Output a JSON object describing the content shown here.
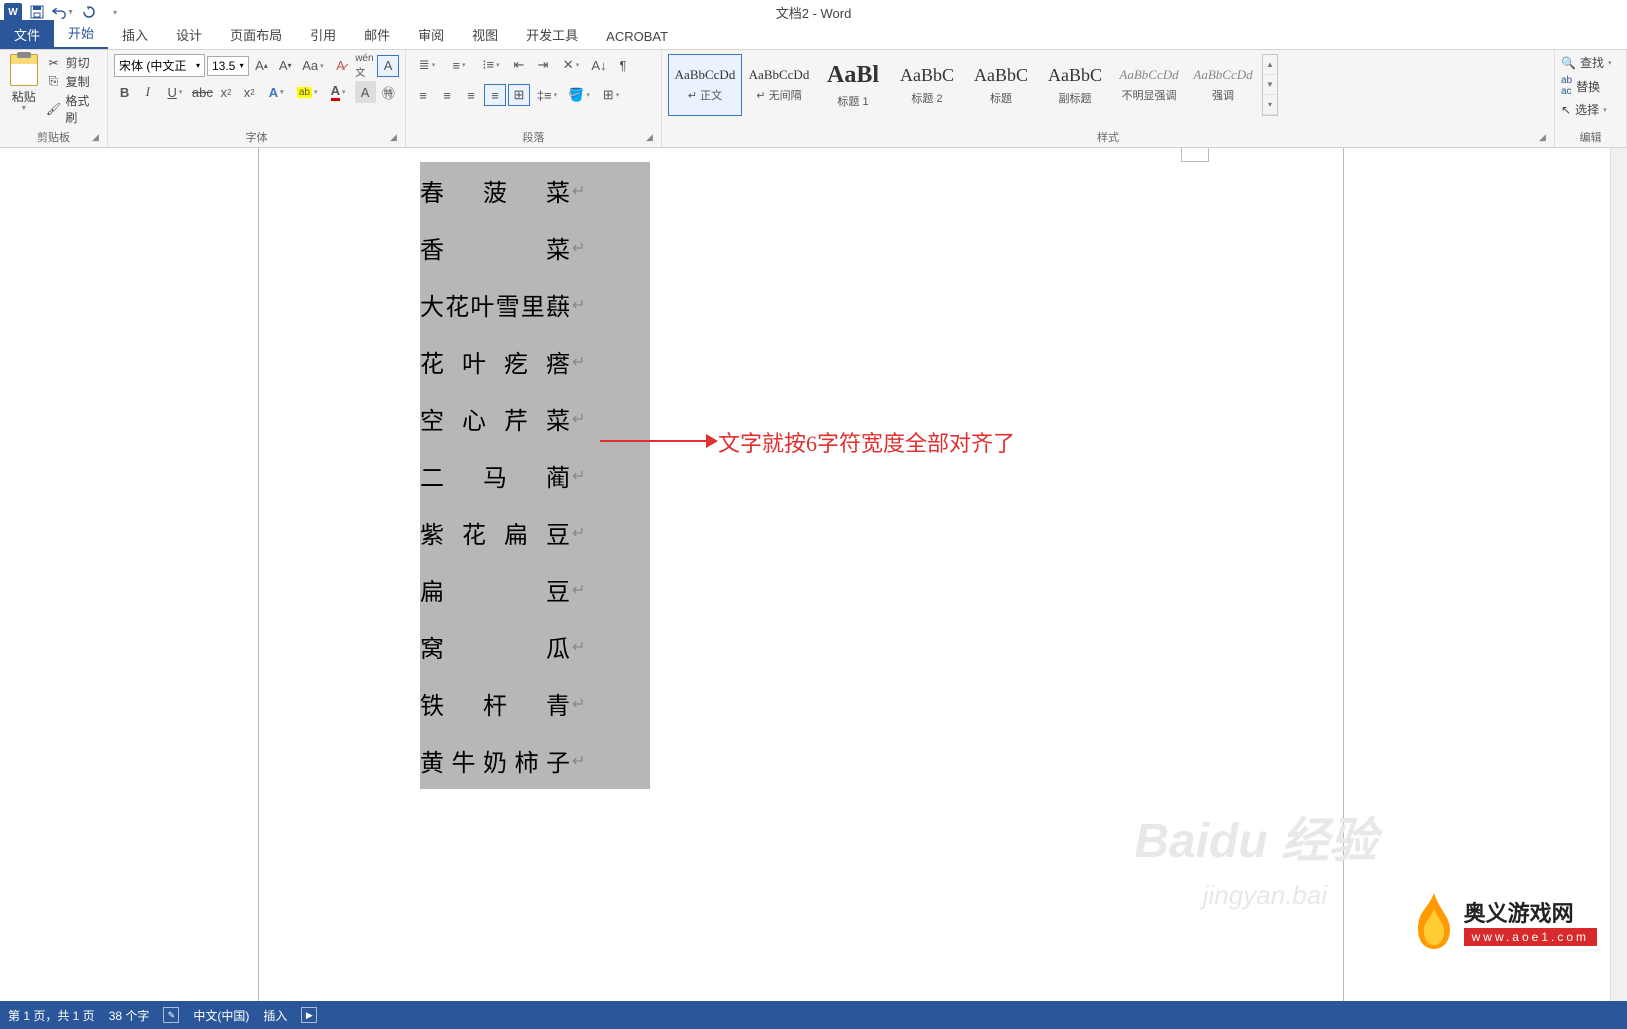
{
  "app": {
    "title": "文档2 - Word"
  },
  "qat": {
    "save": "save",
    "undo": "undo",
    "redo": "redo"
  },
  "tabs": {
    "file": "文件",
    "home": "开始",
    "insert": "插入",
    "design": "设计",
    "layout": "页面布局",
    "references": "引用",
    "mailings": "邮件",
    "review": "审阅",
    "view": "视图",
    "developer": "开发工具",
    "acrobat": "ACROBAT"
  },
  "clipboard": {
    "paste": "粘贴",
    "cut": "剪切",
    "copy": "复制",
    "formatPainter": "格式刷",
    "group": "剪贴板"
  },
  "font": {
    "name": "宋体 (中文正",
    "size": "13.5",
    "group": "字体",
    "bold": "B",
    "italic": "I",
    "underline": "U",
    "strike": "abc",
    "sub": "x",
    "sup": "x"
  },
  "paragraph": {
    "group": "段落"
  },
  "styles": {
    "group": "样式",
    "items": [
      {
        "preview": "AaBbCcDd",
        "name": "↵ 正文",
        "size": "13px"
      },
      {
        "preview": "AaBbCcDd",
        "name": "↵ 无间隔",
        "size": "13px"
      },
      {
        "preview": "AaBl",
        "name": "标题 1",
        "size": "24px",
        "bold": true
      },
      {
        "preview": "AaBbC",
        "name": "标题 2",
        "size": "18px"
      },
      {
        "preview": "AaBbC",
        "name": "标题",
        "size": "18px"
      },
      {
        "preview": "AaBbC",
        "name": "副标题",
        "size": "18px"
      },
      {
        "preview": "AaBbCcDd",
        "name": "不明显强调",
        "size": "13px",
        "italic": true,
        "gray": true
      },
      {
        "preview": "AaBbCcDd",
        "name": "强调",
        "size": "13px",
        "italic": true,
        "gray": true
      }
    ]
  },
  "editing": {
    "find": "查找",
    "replace": "替换",
    "select": "选择",
    "group": "编辑"
  },
  "document": {
    "lines": [
      "春菠菜",
      "香菜",
      "大花叶雪里蕻",
      "花叶疙瘩",
      "空心芹菜",
      "二马蔺",
      "紫花扁豆",
      "扁豆",
      "窝瓜",
      "铁杆青",
      "黄牛奶柿子"
    ],
    "annotation": "文字就按6字符宽度全部对齐了"
  },
  "watermark": {
    "main": "Baidu 经验",
    "sub": "jingyan.bai",
    "logo_cn": "奥义游戏网",
    "logo_url": "www.aoe1.com"
  },
  "statusbar": {
    "page": "第 1 页，共 1 页",
    "words": "38 个字",
    "lang": "中文(中国)",
    "mode": "插入"
  }
}
